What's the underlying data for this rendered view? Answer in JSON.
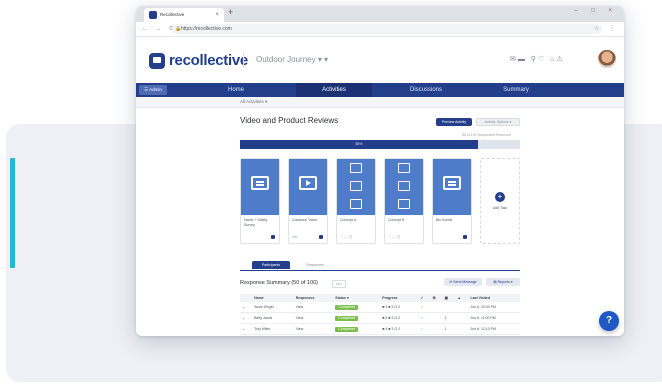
{
  "browser": {
    "tab_title": "Recollective",
    "tab_close": "×",
    "new_tab": "+",
    "window_controls": "– □ ×",
    "nav_buttons": "← → ⟳",
    "lock_icon": "🔒",
    "url": "https://recollective.com",
    "address_right": "☆ ⋮"
  },
  "app": {
    "brand": "recollective",
    "project_name": "Outdoor Journey ▾ ▾",
    "header_icons": "✉▬  ⚲♡  ⌂⚠",
    "menu_button": "☰ Admin",
    "accent_color": "#233e8b"
  },
  "nav": {
    "items": [
      {
        "label": "Home",
        "active": false
      },
      {
        "label": "Activities",
        "active": true
      },
      {
        "label": "Discussions",
        "active": false
      },
      {
        "label": "Summary",
        "active": false
      }
    ],
    "breadcrumb": "All Activities ▾"
  },
  "activity": {
    "title": "Video and Product Reviews",
    "preview_button": "Preview Activity",
    "options_button": "Activity Options ▾",
    "response_count": "85 of 100 Responses Received",
    "progress_label": "85%",
    "progress_fraction": 0.85
  },
  "cards": [
    {
      "name": "Name + Safety Survey",
      "icon": "screen-icon",
      "meta": ""
    },
    {
      "name": "Outdoors! Video",
      "icon": "video-icon",
      "meta": "0/8"
    },
    {
      "name": "Concept A",
      "icon": "stacked-icons",
      "meta": "⬚ —   ◫"
    },
    {
      "name": "Concept B",
      "icon": "stacked-icons",
      "meta": "⬚ —   ◫"
    },
    {
      "name": "Bin Sorted",
      "icon": "screen-icon",
      "meta": ""
    },
    {
      "name": "Add Task",
      "icon": "plus-icon",
      "meta": ""
    }
  ],
  "tabs": [
    {
      "label": "Participants",
      "active": true
    },
    {
      "label": "Responses",
      "active": false
    }
  ],
  "summary": {
    "title": "Response Summary (50 of 100)",
    "select": "50 ▾",
    "send_button": "✉ Send Message",
    "report_button": "▤ Reports ▾"
  },
  "table": {
    "columns": [
      "",
      "Name",
      "Responses",
      "Status ▾",
      "Progress",
      "✓",
      "⊞",
      "▦",
      "▲",
      "Last Visited"
    ],
    "rows": [
      [
        "⌄",
        "Suzie Singer",
        "View",
        "Completed",
        "■ 4  ■ 3  ⊡ 2",
        "✓",
        "",
        "",
        "",
        "Jun 6, 10:30 PM"
      ],
      [
        "⌄",
        "Betty Jarvis",
        "View",
        "Completed",
        "■ 4  ■ 3  ⊡ 2",
        "✓",
        "",
        "2",
        "",
        "Jun 6, 11:00 PM"
      ],
      [
        "⌄",
        "Troy Miles",
        "View",
        "Completed",
        "■ 4  ■ 3  ⊡ 2",
        "✓",
        "",
        "1",
        "",
        "Jun 6, 12:10 PM"
      ]
    ]
  },
  "help": "?"
}
